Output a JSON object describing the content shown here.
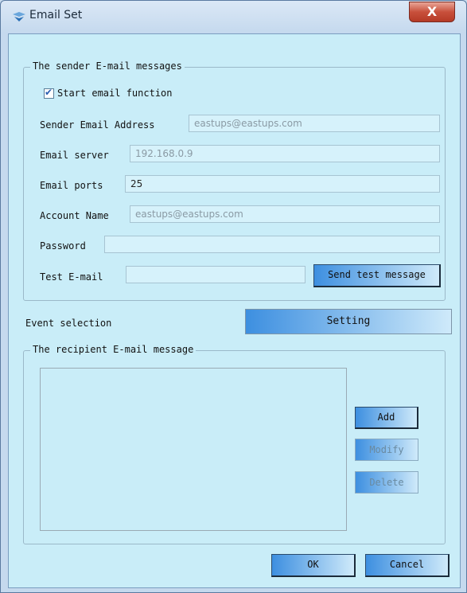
{
  "window": {
    "title": "Email Set",
    "close_label": "X"
  },
  "sender": {
    "legend": "The sender E-mail messages",
    "enable_label": "Start email function",
    "enable_checked": true,
    "sender_address_label": "Sender Email Address",
    "sender_address_value": "eastups@eastups.com",
    "server_label": "Email server",
    "server_value": "192.168.0.9",
    "port_label": "Email ports",
    "port_value": "25",
    "account_label": "Account Name",
    "account_value": "eastups@eastups.com",
    "password_label": "Password",
    "password_value": "",
    "test_label": "Test E-mail",
    "test_value": "",
    "send_test_label": "Send test message"
  },
  "event": {
    "label": "Event selection",
    "setting_label": "Setting"
  },
  "recipient": {
    "legend": "The recipient E-mail message",
    "items": [],
    "add_label": "Add",
    "modify_label": "Modify",
    "delete_label": "Delete"
  },
  "footer": {
    "ok_label": "OK",
    "cancel_label": "Cancel"
  }
}
